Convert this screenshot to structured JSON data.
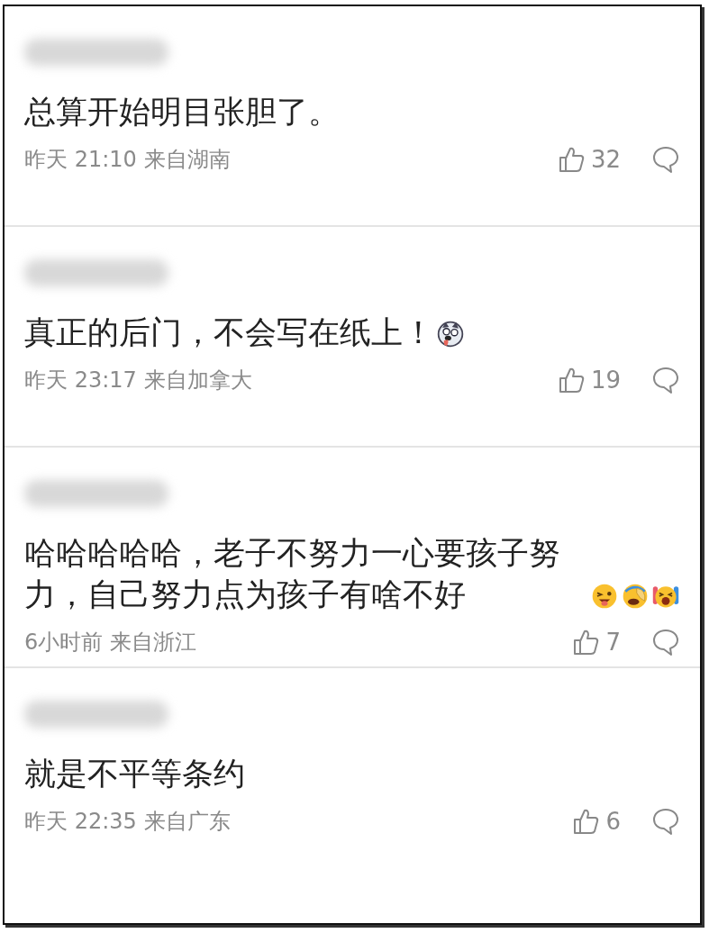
{
  "comments": [
    {
      "text": "总算开始明目张胆了。",
      "time": "昨天 21:10",
      "location": "来自湖南",
      "likes": "32"
    },
    {
      "text": "真正的后门，不会写在纸上！",
      "emojis": [
        {
          "kind": "husky"
        }
      ],
      "time": "昨天 23:17",
      "location": "来自加拿大",
      "likes": "19"
    },
    {
      "text": "哈哈哈哈哈，老子不努力一心要孩子努力，自己努力点为孩子有啥不好",
      "emojis": [
        {
          "kind": "wink"
        },
        {
          "kind": "facepalm"
        },
        {
          "kind": "cheer"
        }
      ],
      "time": "6小时前",
      "location": "来自浙江",
      "likes": "7"
    },
    {
      "text": "就是不平等条约",
      "time": "昨天 22:35",
      "location": "来自广东",
      "likes": "6"
    }
  ]
}
